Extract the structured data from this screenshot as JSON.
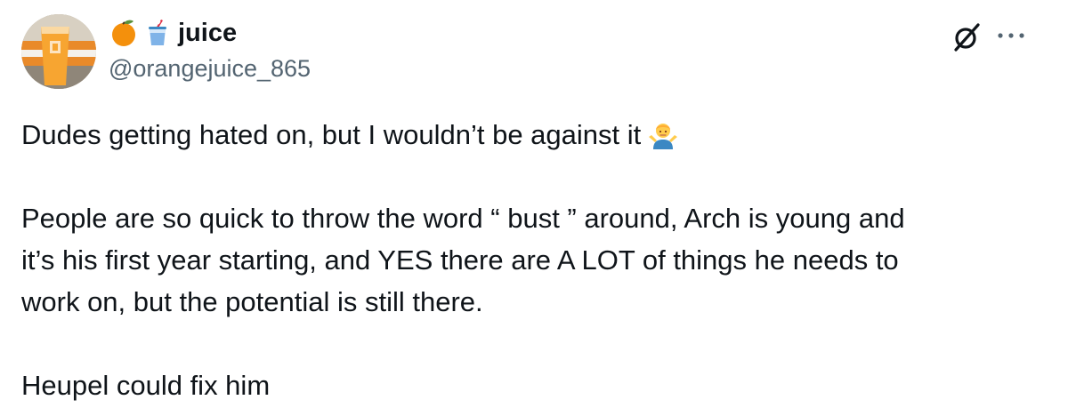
{
  "user": {
    "display_name": "juice",
    "handle": "@orangejuice_865",
    "name_emojis": [
      "orange-emoji",
      "cup-with-straw-emoji"
    ]
  },
  "tweet": {
    "line1": "Dudes getting hated on, but I wouldn’t be against it",
    "line1_emoji": "person-shrugging-emoji",
    "paragraph2": [
      "People are so quick to throw the word “ bust ” around, Arch is young and",
      "it’s his first year starting, and YES there are A LOT of things he needs to",
      "work on, but the potential is still there."
    ],
    "line3": "Heupel could fix him"
  },
  "icons": {
    "grok": "grok-icon",
    "more": "more-options-icon"
  },
  "colors": {
    "text_primary": "#0f1419",
    "text_secondary": "#536471",
    "orange": "#f58220"
  }
}
